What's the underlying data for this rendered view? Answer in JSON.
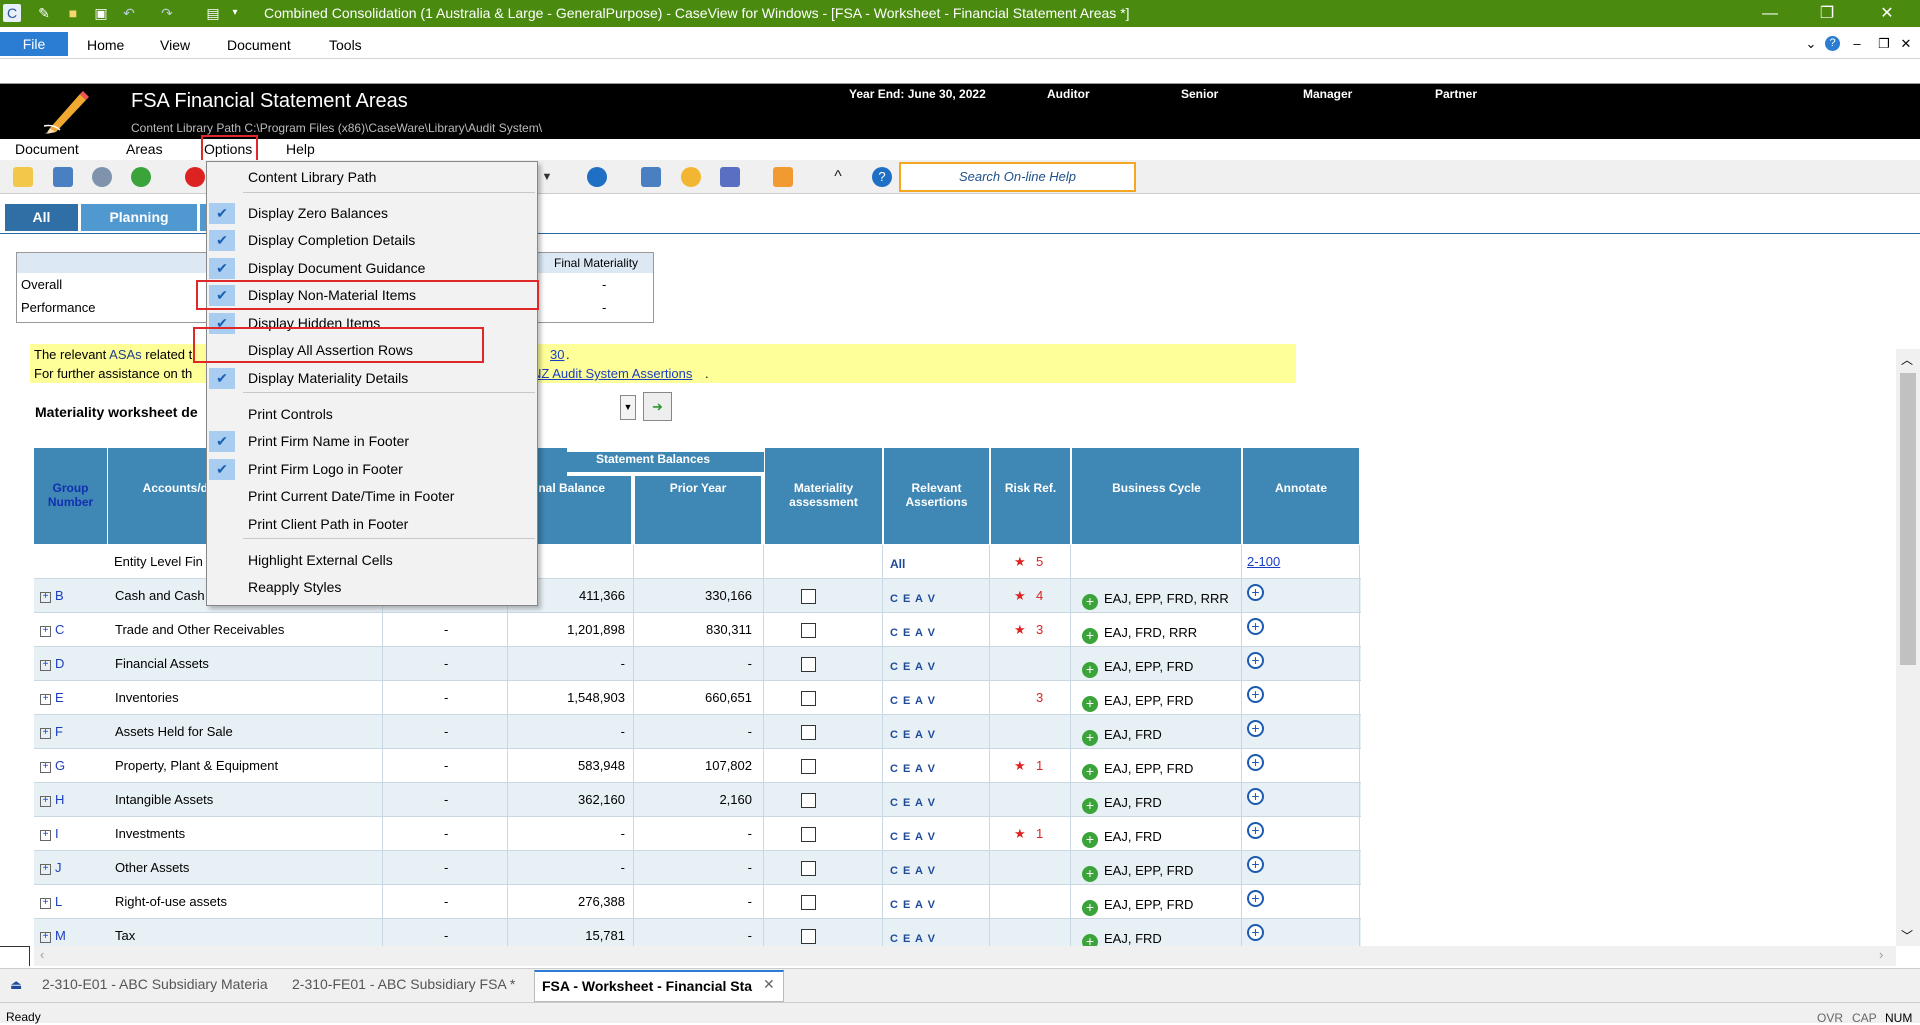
{
  "window": {
    "title": "Combined Consolidation (1 Australia & Large - GeneralPurpose) - CaseView for Windows - [FSA - Worksheet - Financial Statement Areas *]",
    "minimize_icon": "minimize-icon",
    "restore_icon": "restore-icon",
    "close_icon": "close-icon"
  },
  "ribbon": {
    "file": "File",
    "tabs": [
      "Home",
      "View",
      "Document",
      "Tools"
    ]
  },
  "header": {
    "title": "FSA Financial Statement Areas",
    "content_path": "Content Library Path  C:\\Program Files (x86)\\CaseWare\\Library\\Audit System\\",
    "year_end": "Year End: June 30, 2022",
    "auditor": "Auditor",
    "senior": "Senior",
    "manager": "Manager",
    "partner": "Partner"
  },
  "doc_menu": {
    "document": "Document",
    "areas": "Areas",
    "options": "Options",
    "help": "Help"
  },
  "search_help": "Search On-line Help",
  "view_tabs": [
    "All",
    "Planning"
  ],
  "materiality": {
    "header": "Final Materiality",
    "rows": [
      {
        "label": "Overall",
        "value": "-"
      },
      {
        "label": "Performance",
        "value": "-"
      }
    ]
  },
  "notice": {
    "line1_start": "The relevant ",
    "line1_mid": "ASAs",
    "line1_rest": " related t",
    "line1_link": "30",
    "line1_end": ".",
    "line2_start": "For further assistance on th",
    "line2_link": "NZ Audit System Assertions",
    "line2_end": "."
  },
  "materiality_worksheet_label": "Materiality worksheet de",
  "options_menu": {
    "items": [
      {
        "label": "Content Library Path",
        "checked": false
      },
      {
        "label": "Display Zero Balances",
        "checked": true
      },
      {
        "label": "Display Completion Details",
        "checked": true
      },
      {
        "label": "Display Document Guidance",
        "checked": true
      },
      {
        "label": "Display Non-Material Items",
        "checked": true
      },
      {
        "label": "Display Hidden Items",
        "checked": true
      },
      {
        "label": "Display All Assertion Rows",
        "checked": false
      },
      {
        "label": "Display Materiality Details",
        "checked": true
      },
      {
        "label": "Print Controls",
        "checked": false
      },
      {
        "label": "Print Firm Name in Footer",
        "checked": true
      },
      {
        "label": "Print Firm Logo in Footer",
        "checked": true
      },
      {
        "label": "Print Current Date/Time in Footer",
        "checked": false
      },
      {
        "label": "Print Client Path in Footer",
        "checked": false
      },
      {
        "label": "Highlight External Cells",
        "checked": false
      },
      {
        "label": "Reapply Styles",
        "checked": false
      }
    ]
  },
  "grid": {
    "headers": {
      "group": "Group Number",
      "accounts": "Accounts/dis cons",
      "statement_balances": "Statement Balances",
      "final_balance": "inal Balance",
      "prior_year": "Prior Year",
      "materiality": "Materiality assessment",
      "assertions": "Relevant Assertions",
      "risk": "Risk Ref.",
      "cycle": "Business Cycle",
      "annotate": "Annotate"
    },
    "entity_row": {
      "account": "Entity Level Fin",
      "assertions": "All",
      "risk": "5",
      "annotate": "2-100"
    },
    "rows": [
      {
        "group": "B",
        "account": "Cash and Cash",
        "dash": "",
        "final": "411,366",
        "prior": "330,166",
        "assertions": "C E A V",
        "risk": "4",
        "star": true,
        "cycle": "EAJ, EPP, FRD, RRR"
      },
      {
        "group": "C",
        "account": "Trade and Other Receivables",
        "dash": "-",
        "final": "1,201,898",
        "prior": "830,311",
        "assertions": "C E A V",
        "risk": "3",
        "star": true,
        "cycle": "EAJ, FRD, RRR"
      },
      {
        "group": "D",
        "account": "Financial Assets",
        "dash": "-",
        "final": "-",
        "prior": "-",
        "assertions": "C E A V",
        "risk": "",
        "star": false,
        "cycle": "EAJ, EPP, FRD"
      },
      {
        "group": "E",
        "account": "Inventories",
        "dash": "-",
        "final": "1,548,903",
        "prior": "660,651",
        "assertions": "C E A V",
        "risk": "3",
        "star": false,
        "cycle": "EAJ, EPP, FRD"
      },
      {
        "group": "F",
        "account": "Assets Held for Sale",
        "dash": "-",
        "final": "-",
        "prior": "-",
        "assertions": "C E A V",
        "risk": "",
        "star": false,
        "cycle": "EAJ, FRD"
      },
      {
        "group": "G",
        "account": "Property, Plant & Equipment",
        "dash": "-",
        "final": "583,948",
        "prior": "107,802",
        "assertions": "C E A V",
        "risk": "1",
        "star": true,
        "cycle": "EAJ, EPP, FRD"
      },
      {
        "group": "H",
        "account": "Intangible Assets",
        "dash": "-",
        "final": "362,160",
        "prior": "2,160",
        "assertions": "C E A V",
        "risk": "",
        "star": false,
        "cycle": "EAJ, FRD"
      },
      {
        "group": "I",
        "account": "Investments",
        "dash": "-",
        "final": "-",
        "prior": "-",
        "assertions": "C E A V",
        "risk": "1",
        "star": true,
        "cycle": "EAJ, FRD"
      },
      {
        "group": "J",
        "account": "Other Assets",
        "dash": "-",
        "final": "-",
        "prior": "-",
        "assertions": "C E A V",
        "risk": "",
        "star": false,
        "cycle": "EAJ, EPP, FRD"
      },
      {
        "group": "L",
        "account": "Right-of-use assets",
        "dash": "-",
        "final": "276,388",
        "prior": "-",
        "assertions": "C E A V",
        "risk": "",
        "star": false,
        "cycle": "EAJ, EPP, FRD"
      },
      {
        "group": "M",
        "account": "Tax",
        "dash": "-",
        "final": "15,781",
        "prior": "-",
        "assertions": "C E A V",
        "risk": "",
        "star": false,
        "cycle": "EAJ, FRD"
      }
    ]
  },
  "doc_tabs": [
    "2-310-E01 - ABC Subsidiary Materia",
    "2-310-FE01 - ABC Subsidiary FSA *",
    "FSA - Worksheet - Financial Sta"
  ],
  "status": {
    "ready": "Ready",
    "ovr": "OVR",
    "cap": "CAP",
    "num": "NUM"
  },
  "colors": {
    "titlebar": "#4a8a0e",
    "grid_header": "#3f87b4",
    "highlight_box": "#e0282a",
    "row_alt": "#e7f0f5"
  }
}
